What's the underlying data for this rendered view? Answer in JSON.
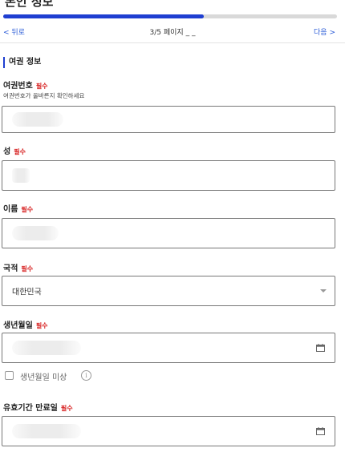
{
  "header": {
    "title": "본인 정보"
  },
  "progress": {
    "fraction": 0.6
  },
  "nav": {
    "back_label": "< 뒤로",
    "page_indicator": "3/5 페이지 _ _",
    "next_label": "다음 >"
  },
  "section": {
    "title": "여권 정보"
  },
  "fields": {
    "passport_number": {
      "label": "여권번호",
      "required": "필수",
      "hint": "여권번호가 올바른지 확인하세요",
      "value": ""
    },
    "surname": {
      "label": "성",
      "required": "필수",
      "value": ""
    },
    "given_name": {
      "label": "이름",
      "required": "필수",
      "value": ""
    },
    "nationality": {
      "label": "국적",
      "required": "필수",
      "value": "대한민국"
    },
    "birth_date": {
      "label": "생년월일",
      "required": "필수",
      "value": ""
    },
    "birth_date_unknown": {
      "label": "생년월일 미상",
      "checked": false
    },
    "expiry_date": {
      "label": "유효기간 만료일",
      "required": "필수",
      "value": ""
    }
  },
  "icons": {
    "back": "chevron-left-icon",
    "next": "chevron-right-icon",
    "dropdown": "chevron-down-icon",
    "calendar": "calendar-icon",
    "info": "info-icon"
  },
  "colors": {
    "accent": "#1f3fd1",
    "link": "#2a5bd7",
    "required": "#d61c1c"
  }
}
